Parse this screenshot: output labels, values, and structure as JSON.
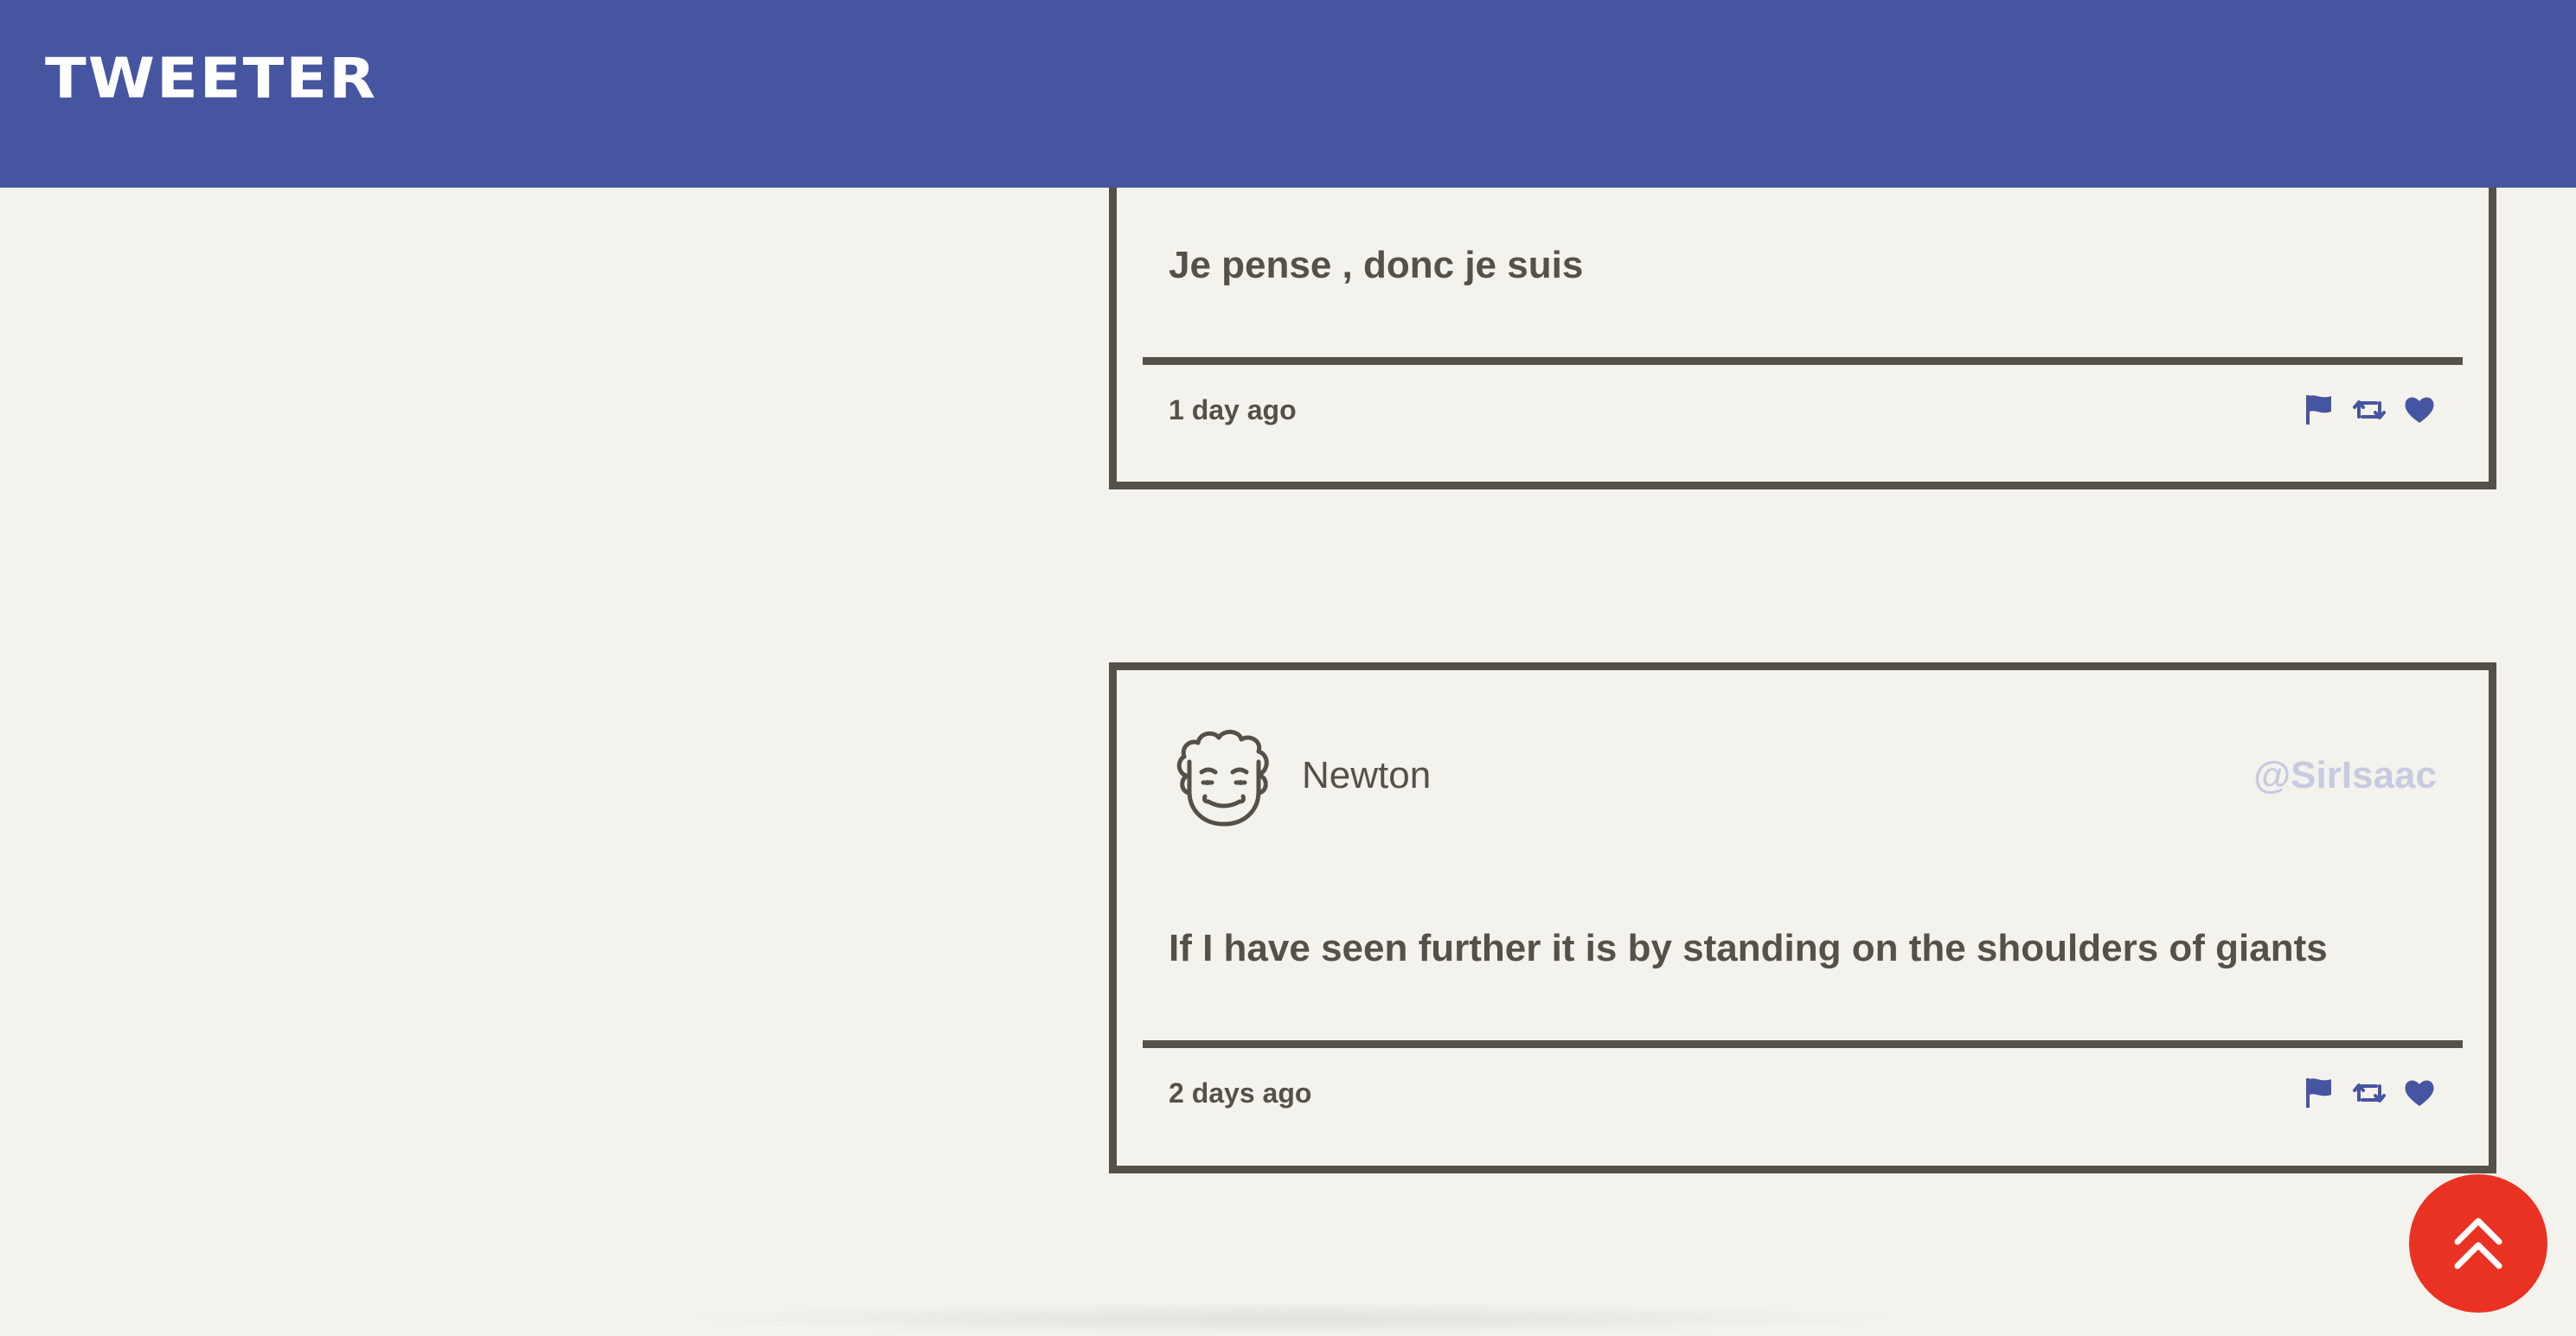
{
  "app": {
    "brand": "TWEETER"
  },
  "colors": {
    "header_bg": "#4655a0",
    "page_bg": "#f4f2ed",
    "text": "#545149",
    "accent_icons": "#4655a0",
    "handle": "#c7cbdf",
    "scroll_button": "#ea3223"
  },
  "tweets": [
    {
      "text": "Je pense , donc je suis",
      "time": "1 day ago",
      "actions": [
        "flag-icon",
        "retweet-icon",
        "heart-icon"
      ]
    },
    {
      "author_name": "Newton",
      "handle": "@SirIsaac",
      "avatar_icon": "newton-avatar-icon",
      "text": "If I have seen further it is by standing on the shoulders of giants",
      "time": "2 days ago",
      "actions": [
        "flag-icon",
        "retweet-icon",
        "heart-icon"
      ]
    }
  ],
  "scroll_top": {
    "icon": "double-chevron-up-icon"
  }
}
